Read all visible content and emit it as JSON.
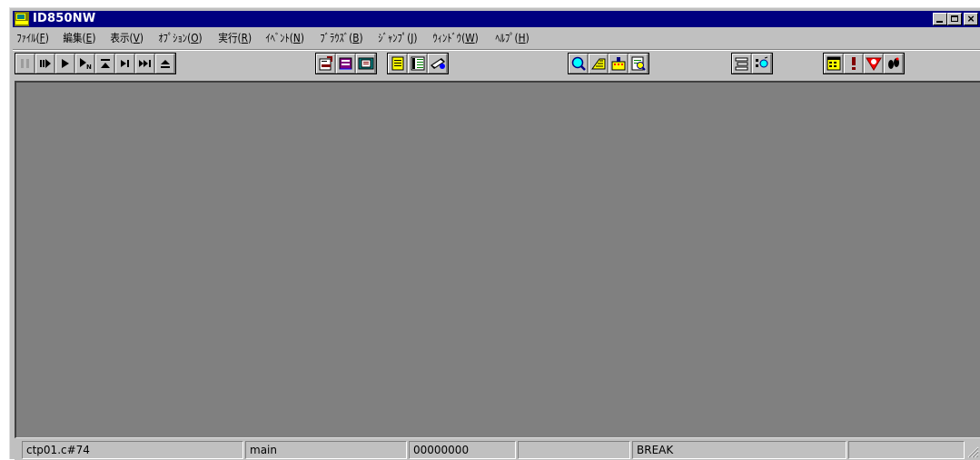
{
  "window": {
    "title": "ID850NW"
  },
  "menubar": {
    "items": [
      {
        "label": "ﾌｧｲﾙ(",
        "acc": "F",
        "tail": ")"
      },
      {
        "label": "編集(",
        "acc": "E",
        "tail": ")"
      },
      {
        "label": "表示(",
        "acc": "V",
        "tail": ")"
      },
      {
        "label": "ｵﾌﾟｼｮﾝ(",
        "acc": "O",
        "tail": ")"
      },
      {
        "label": "実行(",
        "acc": "R",
        "tail": ")"
      },
      {
        "label": "ｲﾍﾞﾝﾄ(",
        "acc": "N",
        "tail": ")"
      },
      {
        "label": "ﾌﾞﾗｳｽﾞ(",
        "acc": "B",
        "tail": ")"
      },
      {
        "label": "ｼﾞｬﾝﾌﾟ(",
        "acc": "J",
        "tail": ")"
      },
      {
        "label": "ｳｨﾝﾄﾞｳ(",
        "acc": "W",
        "tail": ")"
      },
      {
        "label": "ﾍﾙﾌﾟ(",
        "acc": "H",
        "tail": ")"
      }
    ]
  },
  "toolbar": {
    "icons": [
      "stop-icon",
      "restart-icon",
      "go-icon",
      "go-n-icon",
      "return-out-icon",
      "step-in-icon",
      "next-over-icon",
      "eject-icon",
      "download-icon",
      "upload-icon",
      "project-icon",
      "source-window-icon",
      "assemble-window-icon",
      "trace-icon",
      "watch-icon",
      "register-icon",
      "memory-icon",
      "sfr-icon",
      "stack-icon",
      "local-variable-icon",
      "event-manager-icon",
      "break-point-icon",
      "stop-sign-icon",
      "footprint-icon"
    ]
  },
  "statusbar": {
    "file": "ctp01.c#74",
    "function": "main",
    "address": "00000000",
    "empty1": "",
    "state": "BREAK",
    "empty2": ""
  },
  "colors": {
    "titlebar": "#000080",
    "face": "#c0c0c0",
    "client": "#808080"
  }
}
